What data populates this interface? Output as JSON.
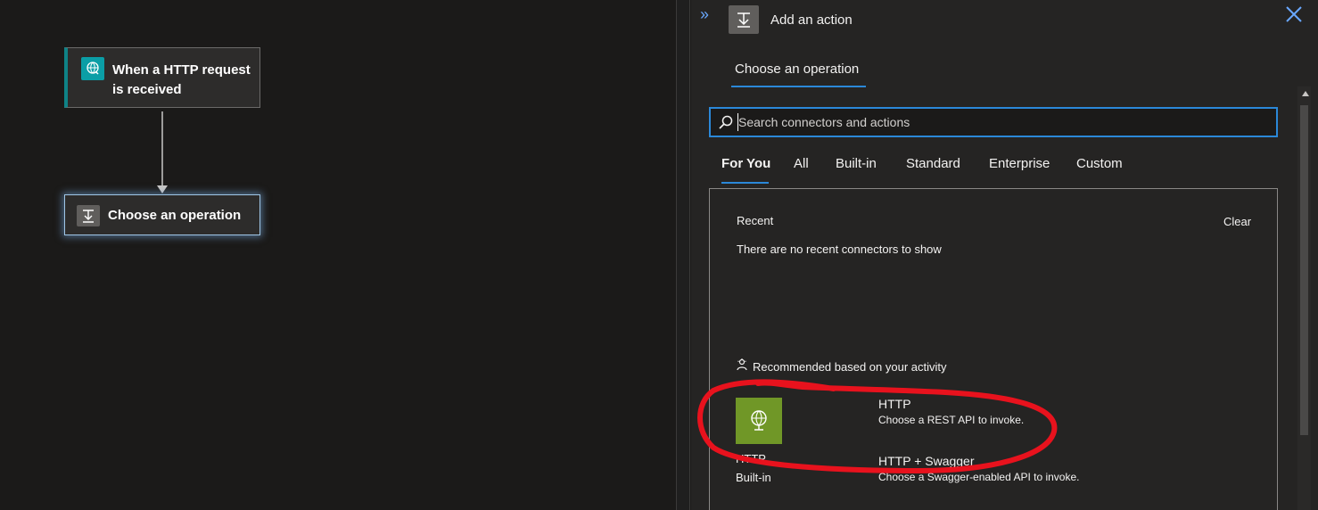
{
  "canvas": {
    "trigger": {
      "title": "When a HTTP request is received",
      "icon": "http-request-trigger-icon"
    },
    "operation": {
      "title": "Choose an operation",
      "icon": "operation-icon"
    }
  },
  "panel": {
    "title": "Add an action",
    "tab": "Choose an operation",
    "search": {
      "placeholder": "Search connectors and actions",
      "value": ""
    },
    "filters": [
      "For You",
      "All",
      "Built-in",
      "Standard",
      "Enterprise",
      "Custom"
    ],
    "active_filter": "For You",
    "recent": {
      "label": "Recent",
      "clear": "Clear",
      "empty": "There are no recent connectors to show"
    },
    "recommended": {
      "label": "Recommended based on your activity",
      "tile": {
        "name": "HTTP",
        "category": "Built-in"
      },
      "actions": [
        {
          "name": "HTTP",
          "description": "Choose a REST API to invoke."
        },
        {
          "name": "HTTP + Swagger",
          "description": "Choose a Swagger-enabled API to invoke."
        }
      ]
    }
  },
  "colors": {
    "accent": "#2b88d8",
    "trigger": "#0b9ea6",
    "http_tile": "#709727",
    "annotation": "#e8121d"
  }
}
